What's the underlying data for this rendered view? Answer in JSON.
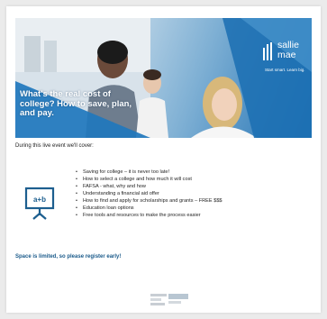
{
  "hero": {
    "heading": "What's the real cost of college? How to save, plan, and pay.",
    "brand_name": "sallie mae",
    "brand_tagline": "Start smart. Learn big.",
    "colors": {
      "brand_blue": "#1d6fb3",
      "sky": "#b9d3e6"
    }
  },
  "intro": "During this live event we'll cover:",
  "board_icon": {
    "name": "presentation-board-icon",
    "text": "a+b"
  },
  "topics": [
    "Saving for college – it is never too late!",
    "How to select a college and how much it will cost",
    "FAFSA - what, why and how",
    "Understanding a financial aid offer",
    "How to find and apply for scholarships and grants – FREE $$$",
    "Education loan options",
    "Free tools and resources to make the process easier"
  ],
  "cta": "Space is limited, so please register early!",
  "colors": {
    "cta": "#1a5a8a",
    "accent": "#1d6fb3"
  }
}
